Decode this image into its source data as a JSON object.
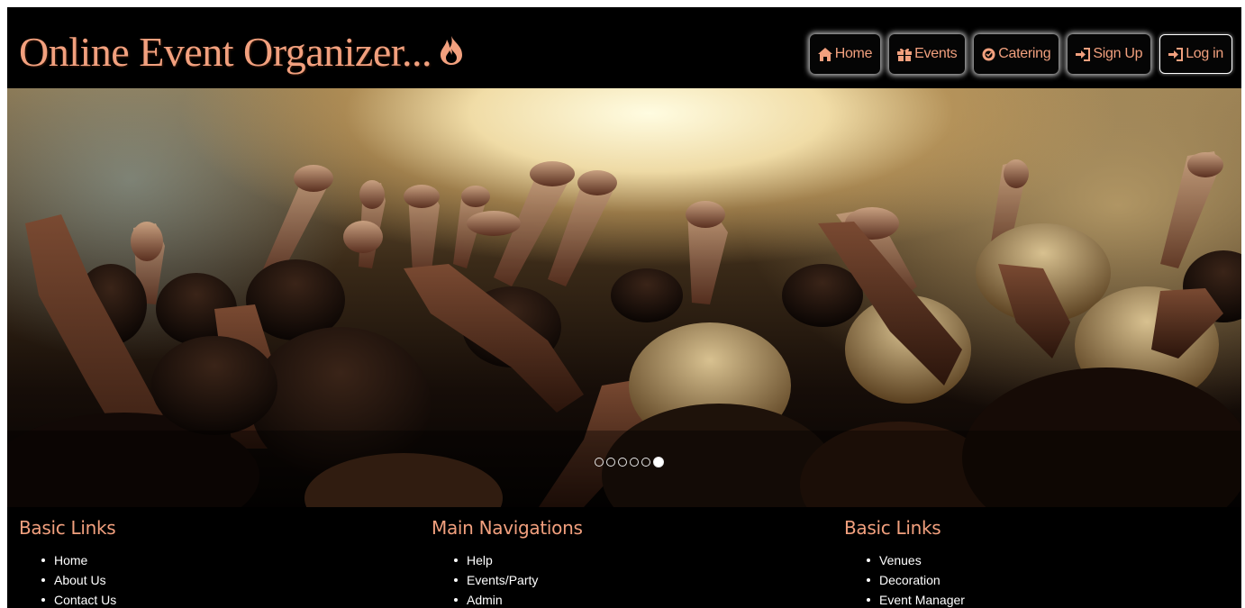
{
  "header": {
    "title": "Online Event Organizer...",
    "title_icon": "fire-icon",
    "nav": [
      {
        "label": "Home",
        "icon": "home-icon"
      },
      {
        "label": "Events",
        "icon": "gift-icon"
      },
      {
        "label": "Catering",
        "icon": "catering-icon"
      },
      {
        "label": "Sign Up",
        "icon": "login-icon"
      },
      {
        "label": "Log in",
        "icon": "login-icon",
        "active": true
      }
    ]
  },
  "carousel": {
    "image": "concert crowd with raised hands",
    "slide_count": 6,
    "active_slide": 6
  },
  "footer": {
    "columns": [
      {
        "title": "Basic Links",
        "links": [
          "Home",
          "About Us",
          "Contact Us"
        ]
      },
      {
        "title": "Main Navigations",
        "links": [
          "Help",
          "Events/Party",
          "Admin"
        ]
      },
      {
        "title": "Basic Links",
        "links": [
          "Venues",
          "Decoration",
          "Event Manager"
        ]
      }
    ]
  },
  "colors": {
    "accent": "#f2a07e",
    "background": "#000000",
    "link_text": "#ffffff"
  }
}
